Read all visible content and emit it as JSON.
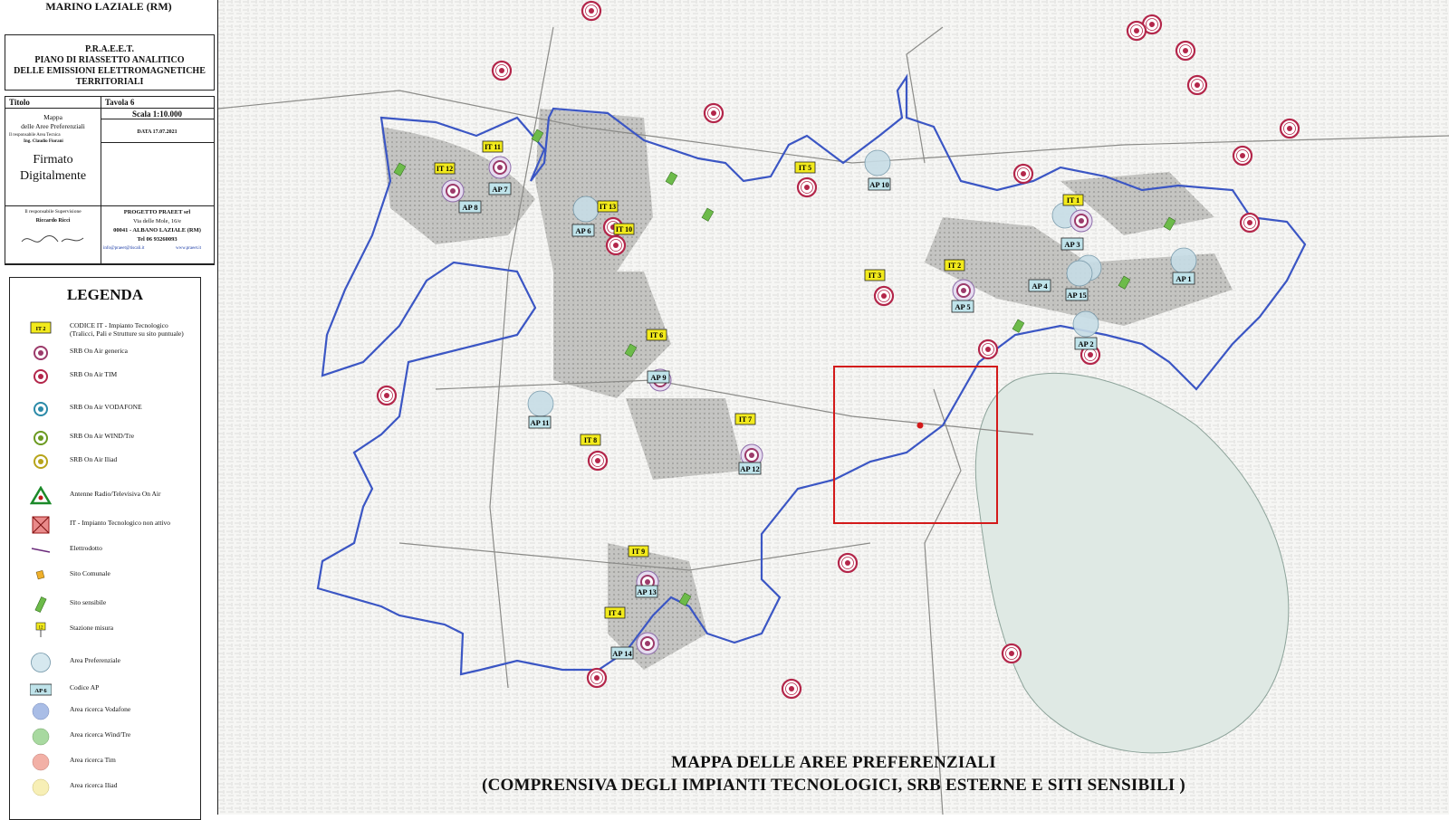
{
  "header": {
    "town": "MARINO LAZIALE (RM)"
  },
  "praeet": {
    "acronym": "P.R.A.E.E.T.",
    "line1": "PIANO DI RIASSETTO ANALITICO",
    "line2": "DELLE EMISSIONI ELETTROMAGNETICHE",
    "line3": "TERRITORIALI"
  },
  "info": {
    "titolo_label": "Titolo",
    "tavola": "Tavola 6",
    "mappa": "Mappa",
    "mappa_sub": "delle Aree Preferenziali",
    "scala": "Scala 1:10.000",
    "resp_label": "Il responsabile Area Tecnica",
    "resp_name": "Ing. Claudio Fiorani",
    "data": "DATA 17.07.2021",
    "firmato1": "Firmato",
    "firmato2": "Digitalmente",
    "sup_label": "Il responsabile Supervisione",
    "sup_name": "Riccardo Ricci",
    "company": "PROGETTO PRAEET srl",
    "addr1": "Via delle Mole, 16/e",
    "addr2": "00041 - ALBANO LAZIALE (RM)",
    "tel": "Tel  06 93260093",
    "email": "info@praeet@tiscali.it",
    "web": "www.praeet.it"
  },
  "legend": {
    "title": "LEGENDA",
    "items": [
      {
        "sym": "it-box",
        "sym_text": "IT 2",
        "text": "CODICE IT - Impianto Tecnologico",
        "text2": "(Tralicci, Pali e Strutture su sito puntuale)"
      },
      {
        "sym": "srb-generica",
        "text": "SRB On Air generica"
      },
      {
        "sym": "srb-tim",
        "text": "SRB On Air TIM"
      },
      {
        "sym": "srb-vodafone",
        "text": "SRB On Air VODAFONE"
      },
      {
        "sym": "srb-wind",
        "text": "SRB On Air WIND/Tre"
      },
      {
        "sym": "srb-iliad",
        "text": "SRB On Air Iliad"
      },
      {
        "sym": "antenna-radio",
        "text": "Antenne Radio/Televisiva On Air"
      },
      {
        "sym": "it-non-attivo",
        "text": "IT - Impianto Tecnologico non attivo"
      },
      {
        "sym": "elettrodotto",
        "text": "Elettrodotto"
      },
      {
        "sym": "sito-comunale",
        "text": "Sito Comunale"
      },
      {
        "sym": "sito-sensibile",
        "text": "Sito sensibile"
      },
      {
        "sym": "stazione-misura",
        "sym_text": "12",
        "text": "Stazione misura"
      },
      {
        "sym": "area-preferenziale",
        "text": "Area Preferenziale"
      },
      {
        "sym": "ap-box",
        "sym_text": "AP 6",
        "text": "Codice AP"
      },
      {
        "sym": "area-vodafone",
        "text": "Area ricerca Vodafone"
      },
      {
        "sym": "area-wind",
        "text": "Area ricerca Wind/Tre"
      },
      {
        "sym": "area-tim",
        "text": "Area ricerca Tim"
      },
      {
        "sym": "area-iliad",
        "text": "Area ricerca Iliad"
      }
    ]
  },
  "map": {
    "title1": "MAPPA DELLE AREE PREFERENZIALI",
    "title2": "(COMPRENSIVA DEGLI IMPIANTI TECNOLOGICI, SRB ESTERNE E SITI SENSIBILI )",
    "it_labels": [
      "IT 1",
      "IT 2",
      "IT 3",
      "IT 4",
      "IT 5",
      "IT 6",
      "IT 7",
      "IT 8",
      "IT 9",
      "IT 10",
      "IT 11",
      "IT 12",
      "IT 13"
    ],
    "ap_labels": [
      "AP 1",
      "AP 2",
      "AP 3",
      "AP 4",
      "AP 5",
      "AP 6",
      "AP 7",
      "AP 8",
      "AP 9",
      "AP 10",
      "AP 11",
      "AP 12",
      "AP 13",
      "AP 14",
      "AP 15"
    ],
    "colors": {
      "boundary": "#3b56c4",
      "srb": "#b3264a",
      "it_fill": "#f2ea1c",
      "ap_fill": "#bfe3ea",
      "lake": "#dfe9e4",
      "highlight": "#d31a1a"
    }
  }
}
